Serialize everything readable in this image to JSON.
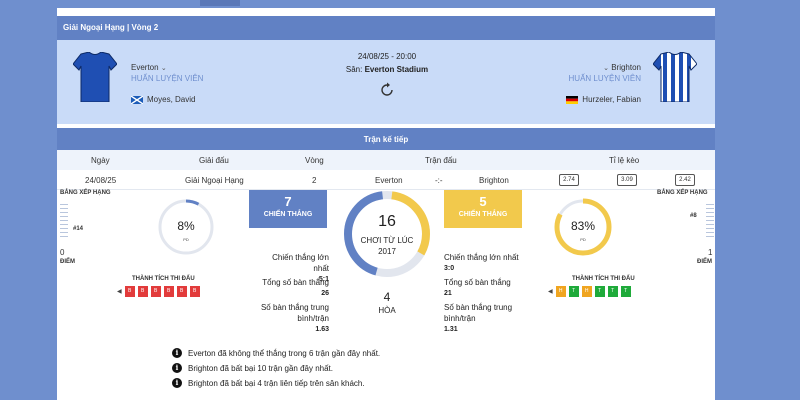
{
  "league": "Giải Ngoại Hạng | Vòng 2",
  "match": {
    "datetime": "24/08/25 - 20:00",
    "venue_label": "Sân:",
    "venue_name": "Everton Stadium",
    "home": {
      "name": "Everton",
      "coach_label": "HUẤN LUYỆN VIÊN",
      "coach": "Moyes, David",
      "flag": "scotland",
      "jersey_color": "#1f4fb3"
    },
    "away": {
      "name": "Brighton",
      "coach_label": "HUẤN LUYỆN VIÊN",
      "coach": "Hurzeler, Fabian",
      "flag": "germany",
      "jersey_color": "#1f4fb3"
    }
  },
  "next_matches": {
    "title": "Trận kế tiếp",
    "headers": {
      "date": "Ngày",
      "league": "Giải đấu",
      "round": "Vòng",
      "match": "Trận đấu",
      "odds": "Tỉ lệ kèo"
    },
    "row": {
      "date": "24/08/25",
      "league": "Giải Ngoại Hạng",
      "round": "2",
      "home": "Everton",
      "sep": "-:-",
      "away": "Brighton",
      "odds": [
        "2.74",
        "3.09",
        "2.42"
      ]
    }
  },
  "standings": {
    "label": "BẢNG XẾP HẠNG",
    "home_rank": "#14",
    "away_rank": "#8",
    "home_points": "0",
    "away_points": "1",
    "points_label": "ĐIỂM"
  },
  "comparison": {
    "home_pct_value": 8,
    "home_pct": "8%",
    "away_pct_value": 83,
    "away_pct": "83%",
    "pct_sub": "PD",
    "home_wins": "7",
    "away_wins": "5",
    "wins_label": "CHIẾN THẮNG",
    "total_matches": "16",
    "since_label": "CHƠI TỪ LÚC",
    "since_year": "2017",
    "draws": "4",
    "draws_label": "HÒA",
    "home_color": "#6181c4",
    "away_color": "#f2c94c",
    "stats": {
      "biggest_win_label": "Chiến thắng lớn nhất",
      "home_biggest_win": "5:1",
      "away_biggest_win": "3:0",
      "total_goals_label": "Tổng số bàn thắng",
      "home_total_goals": "26",
      "away_total_goals": "21",
      "avg_goals_label": "Số bàn thắng trung bình/trận",
      "home_avg_goals": "1.63",
      "away_avg_goals": "1.31"
    }
  },
  "form": {
    "label": "THÀNH TÍCH THI ĐẤU",
    "home": [
      "B",
      "B",
      "B",
      "B",
      "B",
      "B"
    ],
    "away": [
      "H",
      "T",
      "H",
      "T",
      "T",
      "T"
    ]
  },
  "notes": [
    "Everton đã không thể thắng trong 6 trận gần đây nhất.",
    "Brighton đã bất bại 10 trận gần đây nhất.",
    "Brighton đã bất bại 4 trận liên tiếp trên sân khách."
  ]
}
